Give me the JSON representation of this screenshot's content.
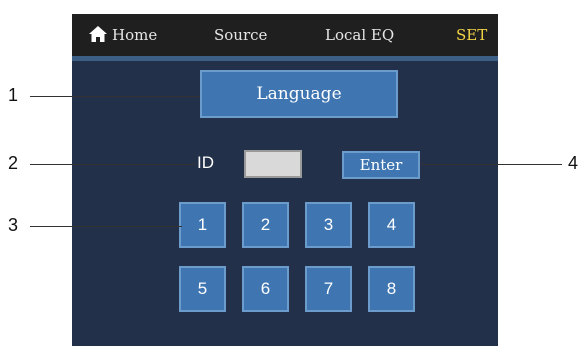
{
  "topbar": {
    "tabs": [
      {
        "label": "Home",
        "icon": "home-icon"
      },
      {
        "label": "Source"
      },
      {
        "label": "Local EQ"
      },
      {
        "label": "SET",
        "active": true
      }
    ]
  },
  "language_button": "Language",
  "id_label": "ID",
  "id_value": "",
  "enter_button": "Enter",
  "keypad": [
    "1",
    "2",
    "3",
    "4",
    "5",
    "6",
    "7",
    "8"
  ],
  "callouts": [
    "1",
    "2",
    "3",
    "4"
  ],
  "colors": {
    "topbar_bg": "#1f1f1f",
    "screen_bg": "#22304a",
    "button_bg": "#3f76b2",
    "active_tab": "#f2d347"
  }
}
